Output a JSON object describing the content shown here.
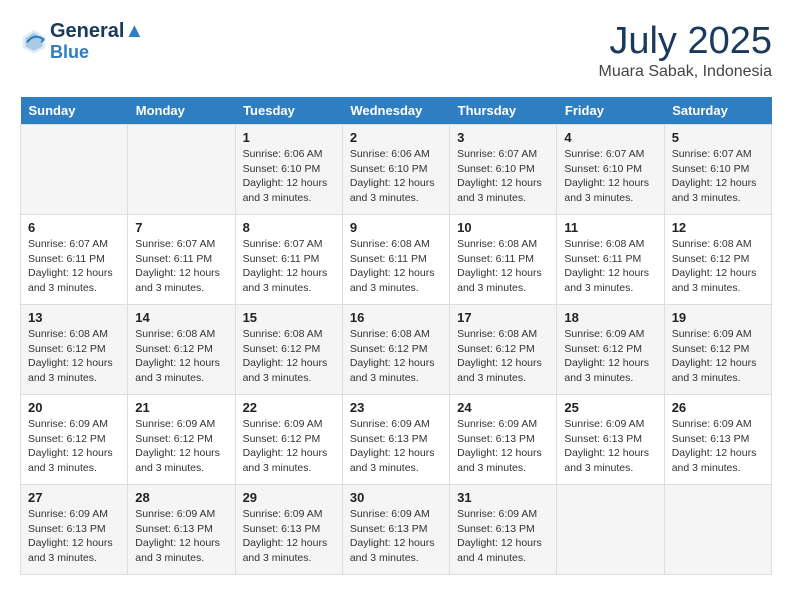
{
  "header": {
    "logo_line1": "General",
    "logo_line2": "Blue",
    "month_year": "July 2025",
    "location": "Muara Sabak, Indonesia"
  },
  "weekdays": [
    "Sunday",
    "Monday",
    "Tuesday",
    "Wednesday",
    "Thursday",
    "Friday",
    "Saturday"
  ],
  "weeks": [
    [
      {
        "day": "",
        "info": ""
      },
      {
        "day": "",
        "info": ""
      },
      {
        "day": "1",
        "info": "Sunrise: 6:06 AM\nSunset: 6:10 PM\nDaylight: 12 hours and 3 minutes."
      },
      {
        "day": "2",
        "info": "Sunrise: 6:06 AM\nSunset: 6:10 PM\nDaylight: 12 hours and 3 minutes."
      },
      {
        "day": "3",
        "info": "Sunrise: 6:07 AM\nSunset: 6:10 PM\nDaylight: 12 hours and 3 minutes."
      },
      {
        "day": "4",
        "info": "Sunrise: 6:07 AM\nSunset: 6:10 PM\nDaylight: 12 hours and 3 minutes."
      },
      {
        "day": "5",
        "info": "Sunrise: 6:07 AM\nSunset: 6:10 PM\nDaylight: 12 hours and 3 minutes."
      }
    ],
    [
      {
        "day": "6",
        "info": "Sunrise: 6:07 AM\nSunset: 6:11 PM\nDaylight: 12 hours and 3 minutes."
      },
      {
        "day": "7",
        "info": "Sunrise: 6:07 AM\nSunset: 6:11 PM\nDaylight: 12 hours and 3 minutes."
      },
      {
        "day": "8",
        "info": "Sunrise: 6:07 AM\nSunset: 6:11 PM\nDaylight: 12 hours and 3 minutes."
      },
      {
        "day": "9",
        "info": "Sunrise: 6:08 AM\nSunset: 6:11 PM\nDaylight: 12 hours and 3 minutes."
      },
      {
        "day": "10",
        "info": "Sunrise: 6:08 AM\nSunset: 6:11 PM\nDaylight: 12 hours and 3 minutes."
      },
      {
        "day": "11",
        "info": "Sunrise: 6:08 AM\nSunset: 6:11 PM\nDaylight: 12 hours and 3 minutes."
      },
      {
        "day": "12",
        "info": "Sunrise: 6:08 AM\nSunset: 6:12 PM\nDaylight: 12 hours and 3 minutes."
      }
    ],
    [
      {
        "day": "13",
        "info": "Sunrise: 6:08 AM\nSunset: 6:12 PM\nDaylight: 12 hours and 3 minutes."
      },
      {
        "day": "14",
        "info": "Sunrise: 6:08 AM\nSunset: 6:12 PM\nDaylight: 12 hours and 3 minutes."
      },
      {
        "day": "15",
        "info": "Sunrise: 6:08 AM\nSunset: 6:12 PM\nDaylight: 12 hours and 3 minutes."
      },
      {
        "day": "16",
        "info": "Sunrise: 6:08 AM\nSunset: 6:12 PM\nDaylight: 12 hours and 3 minutes."
      },
      {
        "day": "17",
        "info": "Sunrise: 6:08 AM\nSunset: 6:12 PM\nDaylight: 12 hours and 3 minutes."
      },
      {
        "day": "18",
        "info": "Sunrise: 6:09 AM\nSunset: 6:12 PM\nDaylight: 12 hours and 3 minutes."
      },
      {
        "day": "19",
        "info": "Sunrise: 6:09 AM\nSunset: 6:12 PM\nDaylight: 12 hours and 3 minutes."
      }
    ],
    [
      {
        "day": "20",
        "info": "Sunrise: 6:09 AM\nSunset: 6:12 PM\nDaylight: 12 hours and 3 minutes."
      },
      {
        "day": "21",
        "info": "Sunrise: 6:09 AM\nSunset: 6:12 PM\nDaylight: 12 hours and 3 minutes."
      },
      {
        "day": "22",
        "info": "Sunrise: 6:09 AM\nSunset: 6:12 PM\nDaylight: 12 hours and 3 minutes."
      },
      {
        "day": "23",
        "info": "Sunrise: 6:09 AM\nSunset: 6:13 PM\nDaylight: 12 hours and 3 minutes."
      },
      {
        "day": "24",
        "info": "Sunrise: 6:09 AM\nSunset: 6:13 PM\nDaylight: 12 hours and 3 minutes."
      },
      {
        "day": "25",
        "info": "Sunrise: 6:09 AM\nSunset: 6:13 PM\nDaylight: 12 hours and 3 minutes."
      },
      {
        "day": "26",
        "info": "Sunrise: 6:09 AM\nSunset: 6:13 PM\nDaylight: 12 hours and 3 minutes."
      }
    ],
    [
      {
        "day": "27",
        "info": "Sunrise: 6:09 AM\nSunset: 6:13 PM\nDaylight: 12 hours and 3 minutes."
      },
      {
        "day": "28",
        "info": "Sunrise: 6:09 AM\nSunset: 6:13 PM\nDaylight: 12 hours and 3 minutes."
      },
      {
        "day": "29",
        "info": "Sunrise: 6:09 AM\nSunset: 6:13 PM\nDaylight: 12 hours and 3 minutes."
      },
      {
        "day": "30",
        "info": "Sunrise: 6:09 AM\nSunset: 6:13 PM\nDaylight: 12 hours and 3 minutes."
      },
      {
        "day": "31",
        "info": "Sunrise: 6:09 AM\nSunset: 6:13 PM\nDaylight: 12 hours and 4 minutes."
      },
      {
        "day": "",
        "info": ""
      },
      {
        "day": "",
        "info": ""
      }
    ]
  ]
}
